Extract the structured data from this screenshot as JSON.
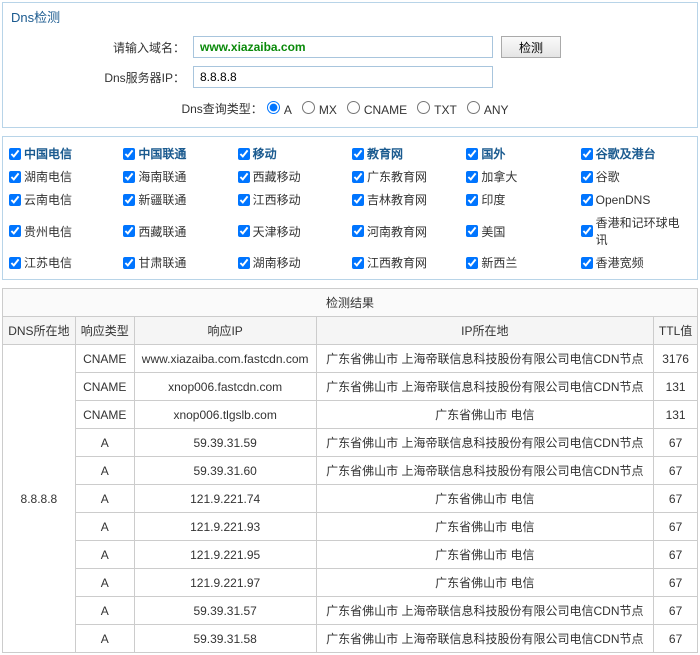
{
  "panel_title": "Dns检测",
  "form": {
    "domain_label": "请输入域名：",
    "domain_value": "www.xiazaiba.com",
    "server_label": "Dns服务器IP：",
    "server_value": "8.8.8.8",
    "query_type_label": "Dns查询类型：",
    "detect_btn": "检测"
  },
  "query_types": [
    "A",
    "MX",
    "CNAME",
    "TXT",
    "ANY"
  ],
  "isp_headers": [
    "中国电信",
    "中国联通",
    "移动",
    "教育网",
    "国外",
    "谷歌及港台"
  ],
  "isp_grid": [
    [
      "湖南电信",
      "海南联通",
      "西藏移动",
      "广东教育网",
      "加拿大",
      "谷歌"
    ],
    [
      "云南电信",
      "新疆联通",
      "江西移动",
      "吉林教育网",
      "印度",
      "OpenDNS"
    ],
    [
      "贵州电信",
      "西藏联通",
      "天津移动",
      "河南教育网",
      "美国",
      "香港和记环球电讯"
    ],
    [
      "江苏电信",
      "甘肃联通",
      "湖南移动",
      "江西教育网",
      "新西兰",
      "香港宽频"
    ]
  ],
  "result_caption": "检测结果",
  "result_headers": [
    "DNS所在地",
    "响应类型",
    "响应IP",
    "IP所在地",
    "TTL值"
  ],
  "dns_location": "8.8.8.8",
  "results": [
    {
      "type": "CNAME",
      "ip": "www.xiazaiba.com.fastcdn.com",
      "loc": "广东省佛山市 上海帝联信息科技股份有限公司电信CDN节点",
      "ttl": "3176"
    },
    {
      "type": "CNAME",
      "ip": "xnop006.fastcdn.com",
      "loc": "广东省佛山市 上海帝联信息科技股份有限公司电信CDN节点",
      "ttl": "131"
    },
    {
      "type": "CNAME",
      "ip": "xnop006.tlgslb.com",
      "loc": "广东省佛山市 电信",
      "ttl": "131"
    },
    {
      "type": "A",
      "ip": "59.39.31.59",
      "loc": "广东省佛山市 上海帝联信息科技股份有限公司电信CDN节点",
      "ttl": "67"
    },
    {
      "type": "A",
      "ip": "59.39.31.60",
      "loc": "广东省佛山市 上海帝联信息科技股份有限公司电信CDN节点",
      "ttl": "67"
    },
    {
      "type": "A",
      "ip": "121.9.221.74",
      "loc": "广东省佛山市 电信",
      "ttl": "67"
    },
    {
      "type": "A",
      "ip": "121.9.221.93",
      "loc": "广东省佛山市 电信",
      "ttl": "67"
    },
    {
      "type": "A",
      "ip": "121.9.221.95",
      "loc": "广东省佛山市 电信",
      "ttl": "67"
    },
    {
      "type": "A",
      "ip": "121.9.221.97",
      "loc": "广东省佛山市 电信",
      "ttl": "67"
    },
    {
      "type": "A",
      "ip": "59.39.31.57",
      "loc": "广东省佛山市 上海帝联信息科技股份有限公司电信CDN节点",
      "ttl": "67"
    },
    {
      "type": "A",
      "ip": "59.39.31.58",
      "loc": "广东省佛山市 上海帝联信息科技股份有限公司电信CDN节点",
      "ttl": "67"
    }
  ]
}
